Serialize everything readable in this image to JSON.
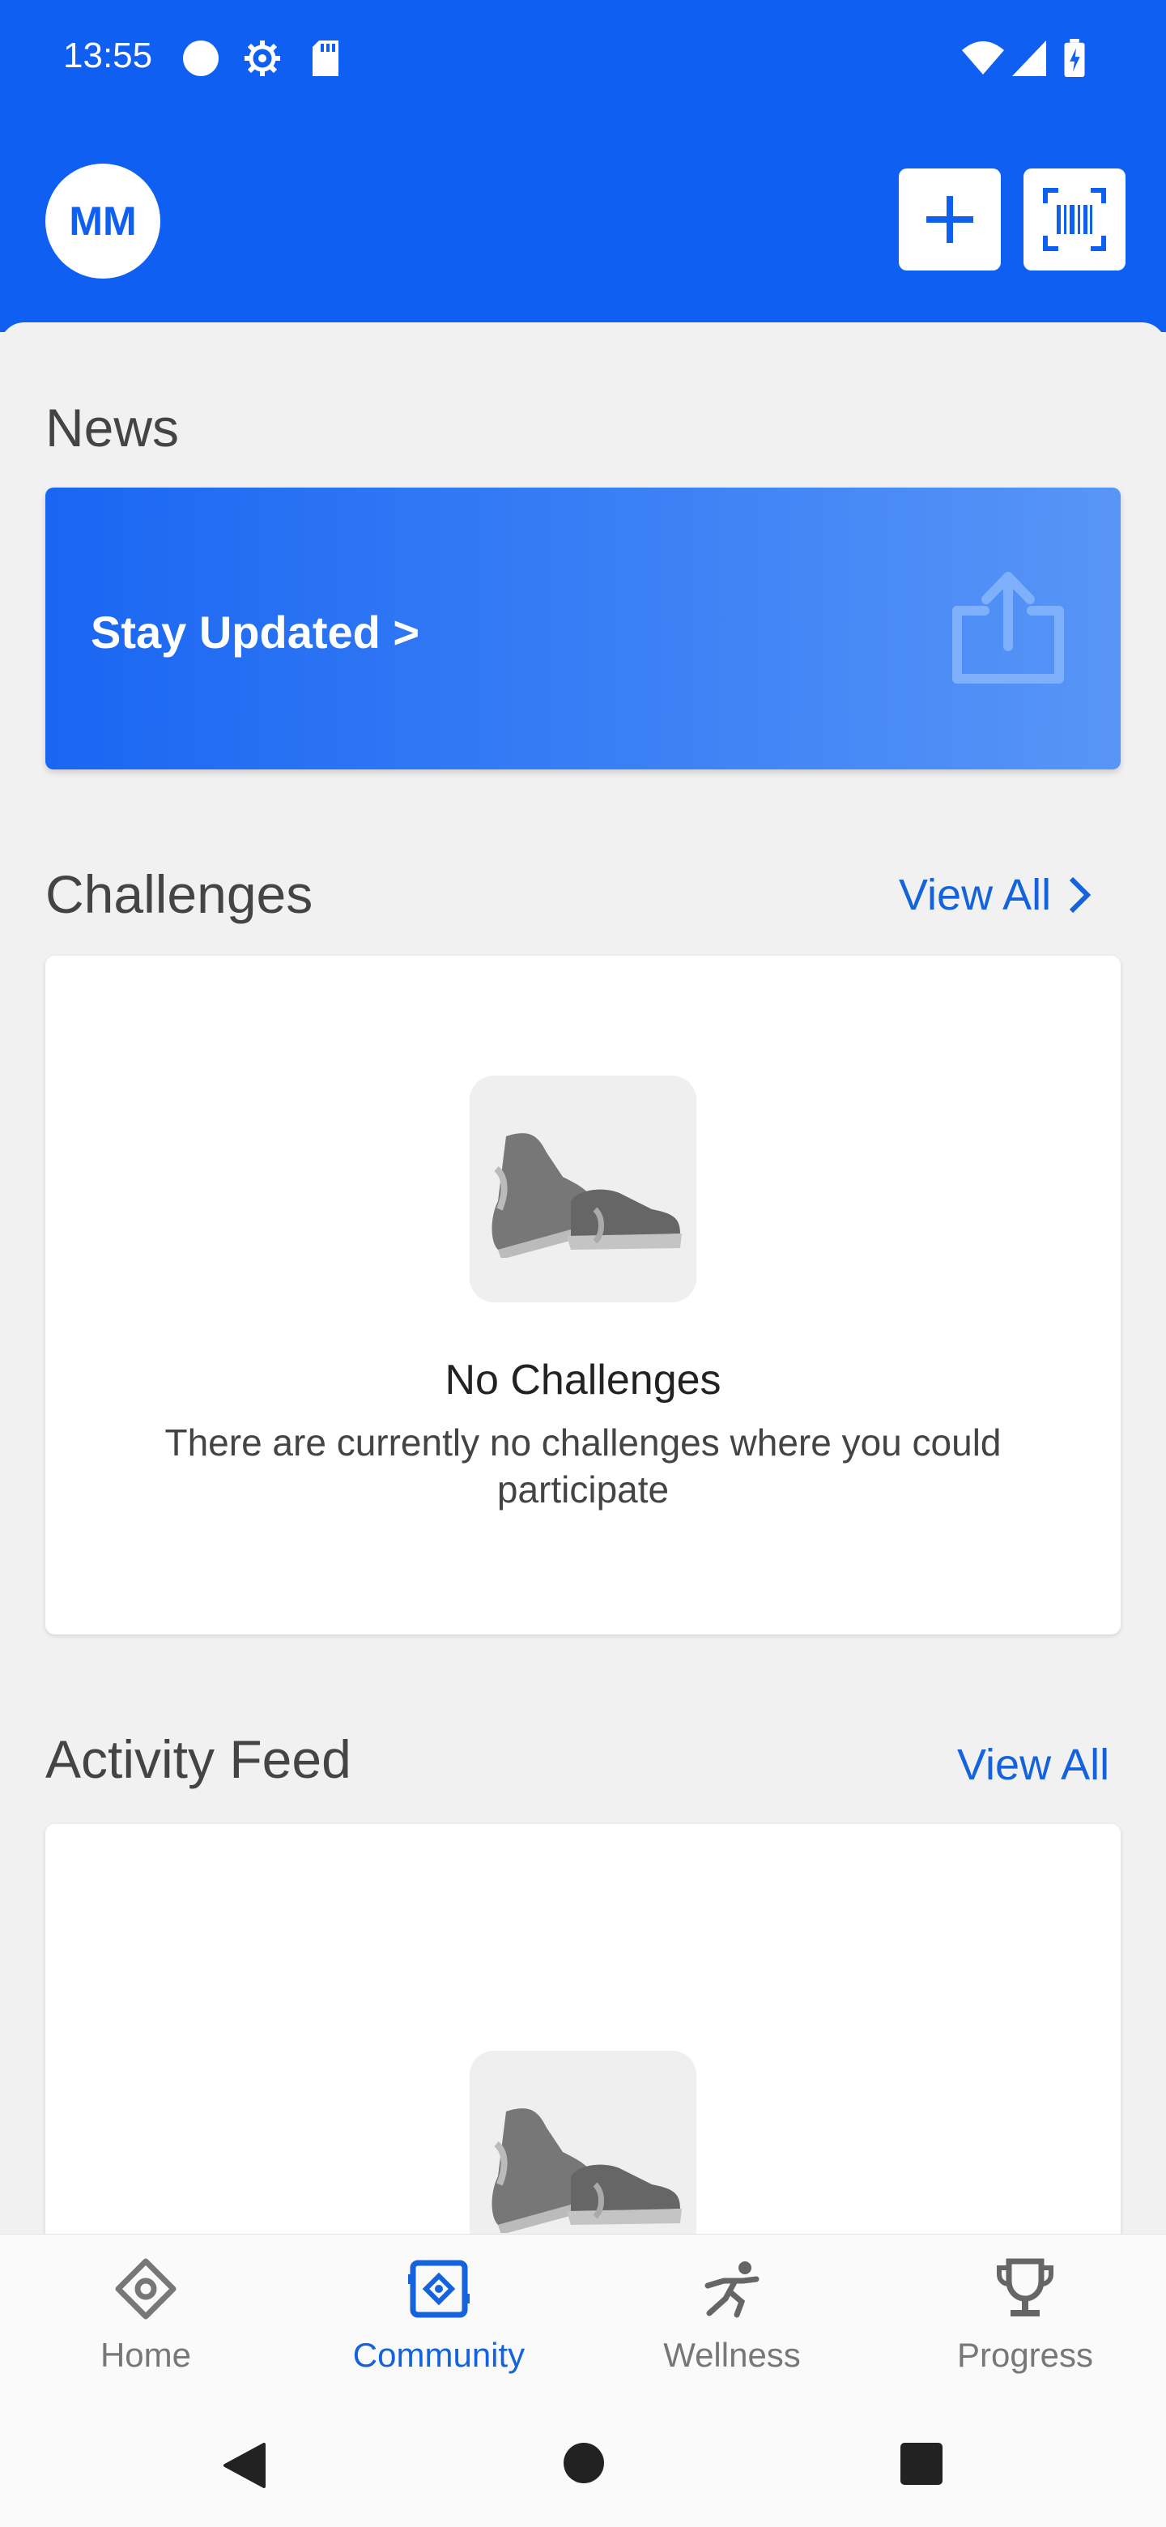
{
  "status_bar": {
    "time": "13:55"
  },
  "app_bar": {
    "avatar_initials": "MM"
  },
  "news": {
    "title": "News",
    "card_text": "Stay Updated >"
  },
  "challenges": {
    "title": "Challenges",
    "view_all": "View All",
    "empty_title": "No Challenges",
    "empty_subtitle": "There are currently no challenges where you could participate"
  },
  "activity_feed": {
    "title": "Activity Feed",
    "view_all": "View All"
  },
  "bottom_nav": {
    "items": [
      {
        "label": "Home",
        "icon": "home-diamond-icon"
      },
      {
        "label": "Community",
        "icon": "community-icon",
        "active": true
      },
      {
        "label": "Wellness",
        "icon": "running-person-icon"
      },
      {
        "label": "Progress",
        "icon": "trophy-icon"
      }
    ]
  },
  "colors": {
    "brand": "#0f5ff2",
    "link": "#1462dc"
  }
}
